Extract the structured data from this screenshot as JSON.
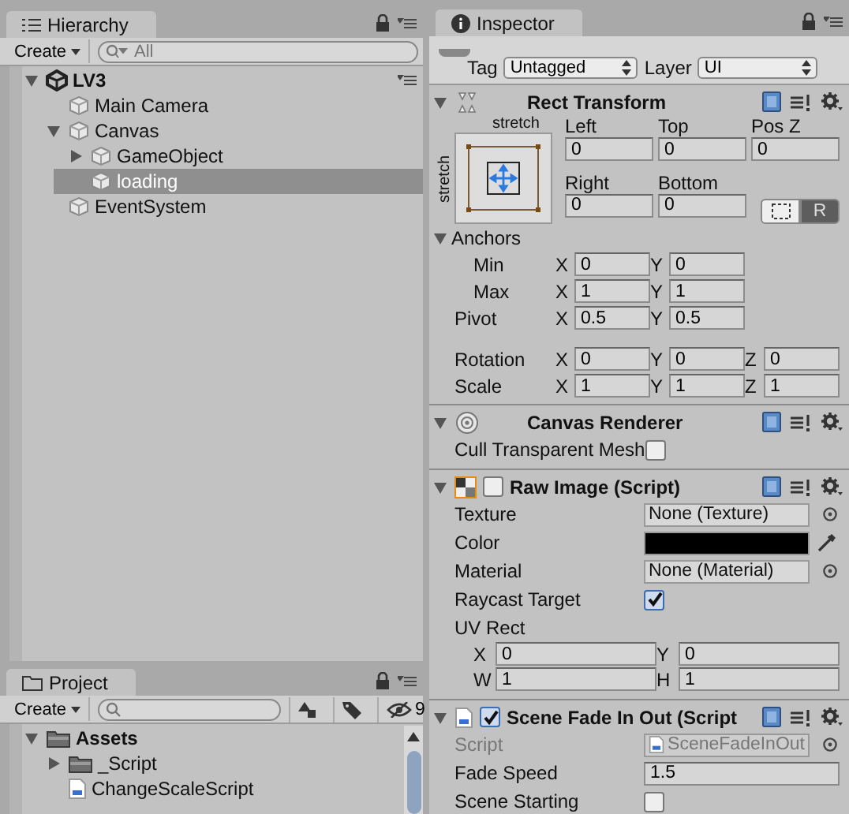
{
  "hierarchy": {
    "title": "Hierarchy",
    "create_label": "Create",
    "search_placeholder": "All",
    "tree": [
      {
        "label": "LV3",
        "kind": "scene",
        "expanded": true,
        "selected": false,
        "children": [
          {
            "label": "Main Camera",
            "kind": "object",
            "selected": false
          },
          {
            "label": "Canvas",
            "kind": "object",
            "expanded": true,
            "selected": false,
            "children": [
              {
                "label": "GameObject",
                "kind": "object",
                "expanded": false,
                "selected": false
              },
              {
                "label": "loading",
                "kind": "object",
                "selected": true
              }
            ]
          },
          {
            "label": "EventSystem",
            "kind": "object",
            "selected": false
          }
        ]
      }
    ]
  },
  "project": {
    "title": "Project",
    "create_label": "Create",
    "hidden_count": "9",
    "tree": [
      {
        "label": "Assets",
        "kind": "folder",
        "expanded": true,
        "selected": false,
        "children": [
          {
            "label": "_Script",
            "kind": "folder",
            "expanded": false,
            "selected": false
          },
          {
            "label": "ChangeScaleScript",
            "kind": "script",
            "selected": false
          }
        ]
      }
    ]
  },
  "inspector": {
    "title": "Inspector",
    "tag": {
      "label": "Tag",
      "value": "Untagged"
    },
    "layer": {
      "label": "Layer",
      "value": "UI"
    },
    "components": [
      {
        "kind": "rect_transform",
        "title": "Rect Transform",
        "expanded": true,
        "anchor_preset": {
          "horizontal": "stretch",
          "vertical": "stretch"
        },
        "edge_fields": [
          {
            "label": "Left",
            "value": "0"
          },
          {
            "label": "Top",
            "value": "0"
          },
          {
            "label": "Pos Z",
            "value": "0"
          },
          {
            "label": "Right",
            "value": "0"
          },
          {
            "label": "Bottom",
            "value": "0"
          }
        ],
        "mode_buttons": [
          {
            "kind": "blueprint",
            "selected": false
          },
          {
            "kind": "raw",
            "label": "R",
            "selected": true
          }
        ],
        "anchors": {
          "label": "Anchors",
          "expanded": true,
          "rows": [
            {
              "label": "Min",
              "fields": [
                {
                  "axis": "X",
                  "value": "0"
                },
                {
                  "axis": "Y",
                  "value": "0"
                }
              ]
            },
            {
              "label": "Max",
              "fields": [
                {
                  "axis": "X",
                  "value": "1"
                },
                {
                  "axis": "Y",
                  "value": "1"
                }
              ]
            }
          ]
        },
        "pivot": {
          "label": "Pivot",
          "fields": [
            {
              "axis": "X",
              "value": "0.5"
            },
            {
              "axis": "Y",
              "value": "0.5"
            }
          ]
        },
        "transform": [
          {
            "label": "Rotation",
            "fields": [
              {
                "axis": "X",
                "value": "0"
              },
              {
                "axis": "Y",
                "value": "0"
              },
              {
                "axis": "Z",
                "value": "0"
              }
            ]
          },
          {
            "label": "Scale",
            "fields": [
              {
                "axis": "X",
                "value": "1"
              },
              {
                "axis": "Y",
                "value": "1"
              },
              {
                "axis": "Z",
                "value": "1"
              }
            ]
          }
        ]
      },
      {
        "kind": "canvas_renderer",
        "title": "Canvas Renderer",
        "expanded": true,
        "properties": [
          {
            "kind": "checkbox",
            "label": "Cull Transparent Mesh",
            "checked": false
          }
        ]
      },
      {
        "kind": "raw_image",
        "title": "Raw Image (Script)",
        "expanded": true,
        "enabled": false,
        "properties": [
          {
            "kind": "object",
            "label": "Texture",
            "value": "None (Texture)",
            "disabled": false
          },
          {
            "kind": "color",
            "label": "Color",
            "color": "#000000"
          },
          {
            "kind": "object",
            "label": "Material",
            "value": "None (Material)",
            "disabled": false
          },
          {
            "kind": "checkbox",
            "label": "Raycast Target",
            "checked": true
          },
          {
            "kind": "rect",
            "label": "UV Rect",
            "fields": [
              {
                "axis": "X",
                "value": "0"
              },
              {
                "axis": "Y",
                "value": "0"
              },
              {
                "axis": "W",
                "value": "1"
              },
              {
                "axis": "H",
                "value": "1"
              }
            ]
          }
        ]
      },
      {
        "kind": "script",
        "title": "Scene Fade In Out (Script",
        "expanded": true,
        "enabled": true,
        "properties": [
          {
            "kind": "object",
            "label": "Script",
            "value": "SceneFadeInOut",
            "disabled": true
          },
          {
            "kind": "text",
            "label": "Fade Speed",
            "value": "1.5"
          },
          {
            "kind": "checkbox",
            "label": "Scene Starting",
            "checked": false
          }
        ]
      }
    ]
  }
}
